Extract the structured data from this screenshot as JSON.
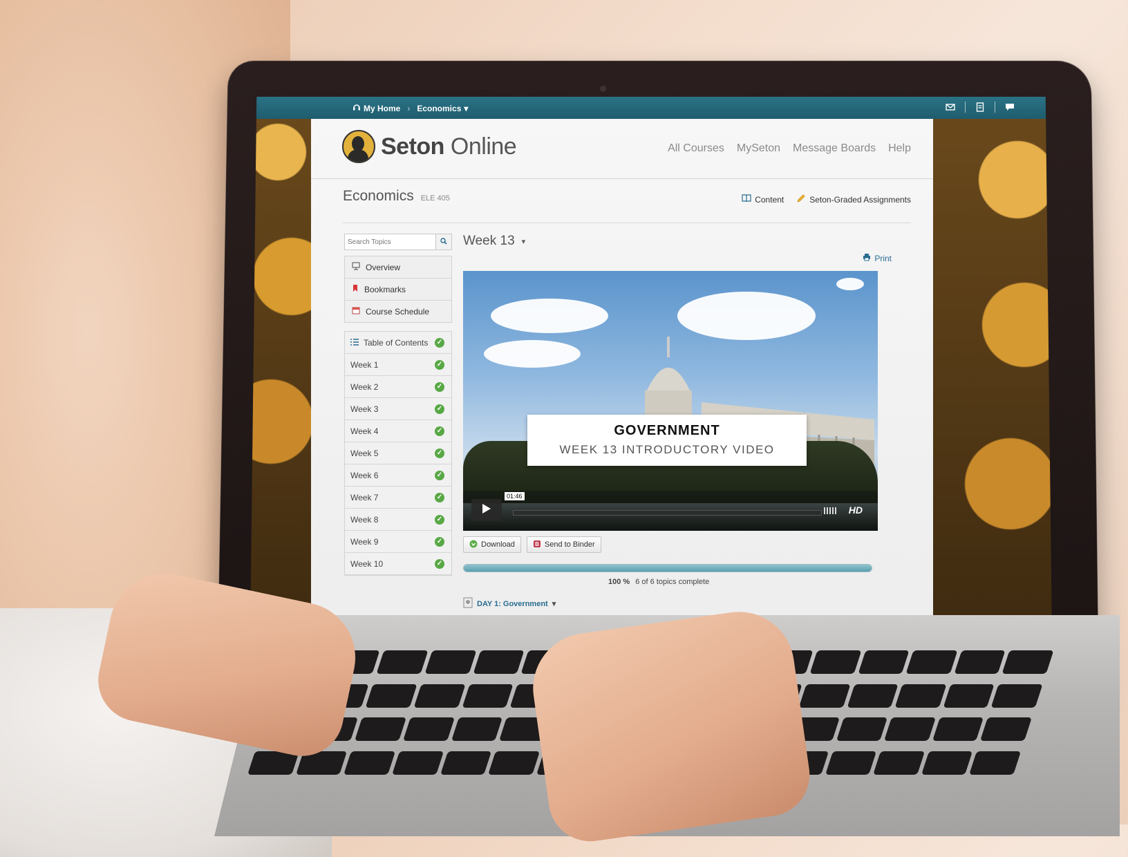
{
  "topbar": {
    "home_label": "My Home",
    "course_label": "Economics",
    "tools": [
      "mail-icon",
      "notes-icon",
      "chat-icon"
    ]
  },
  "site": {
    "logo_bold": "Seton",
    "logo_light": "Online",
    "nav": [
      "All Courses",
      "MySeton",
      "Message Boards",
      "Help"
    ]
  },
  "course": {
    "title": "Economics",
    "code": "ELE 405",
    "links": {
      "content": "Content",
      "assignments": "Seton-Graded Assignments"
    }
  },
  "sidebar": {
    "search_placeholder": "Search Topics",
    "panel_items": [
      {
        "label": "Overview",
        "icon": "overview-icon"
      },
      {
        "label": "Bookmarks",
        "icon": "bookmark-icon"
      },
      {
        "label": "Course Schedule",
        "icon": "calendar-icon"
      }
    ],
    "toc_label": "Table of Contents",
    "weeks": [
      "Week 1",
      "Week 2",
      "Week 3",
      "Week 4",
      "Week 5",
      "Week 6",
      "Week 7",
      "Week 8",
      "Week 9",
      "Week 10"
    ]
  },
  "content": {
    "week_label": "Week 13",
    "print_label": "Print",
    "video": {
      "title": "GOVERNMENT",
      "subtitle": "WEEK 13 INTRODUCTORY VIDEO",
      "time": "01:46",
      "quality": "HD"
    },
    "actions": {
      "download": "Download",
      "binder": "Send to Binder"
    },
    "progress": {
      "percent_label": "100 %",
      "percent": 1.0,
      "topics_label": "6 of 6 topics complete"
    },
    "day_label": "DAY 1: Government"
  },
  "colors": {
    "topbar": "#2a7285",
    "link": "#2a6d91",
    "check": "#58a845"
  }
}
